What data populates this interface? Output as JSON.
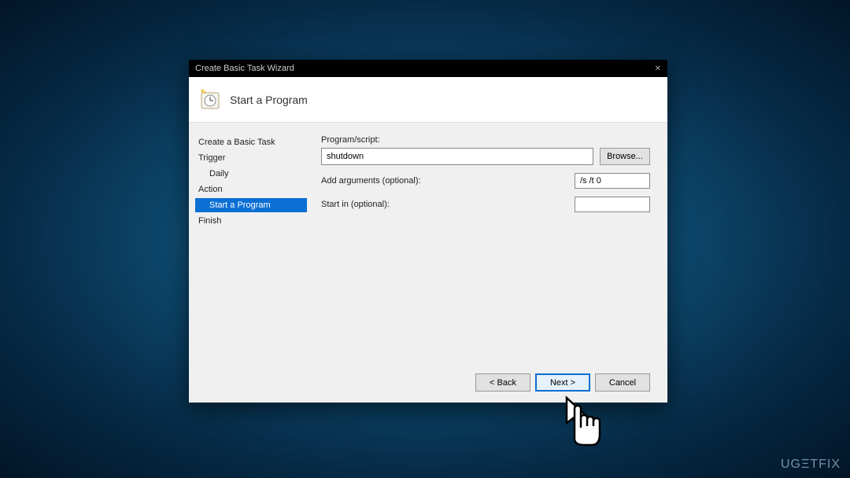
{
  "titlebar": {
    "title": "Create Basic Task Wizard"
  },
  "header": {
    "title": "Start a Program"
  },
  "sidebar": {
    "items": [
      {
        "label": "Create a Basic Task",
        "sub": false,
        "sel": false
      },
      {
        "label": "Trigger",
        "sub": false,
        "sel": false
      },
      {
        "label": "Daily",
        "sub": true,
        "sel": false
      },
      {
        "label": "Action",
        "sub": false,
        "sel": false
      },
      {
        "label": "Start a Program",
        "sub": true,
        "sel": true
      },
      {
        "label": "Finish",
        "sub": false,
        "sel": false
      }
    ]
  },
  "fields": {
    "program_label": "Program/script:",
    "program_value": "shutdown",
    "browse_label": "Browse...",
    "args_label": "Add arguments (optional):",
    "args_value": "/s /t 0",
    "startin_label": "Start in (optional):",
    "startin_value": ""
  },
  "buttons": {
    "back": "< Back",
    "next": "Next >",
    "cancel": "Cancel"
  },
  "watermark": "UGΞTFIX"
}
